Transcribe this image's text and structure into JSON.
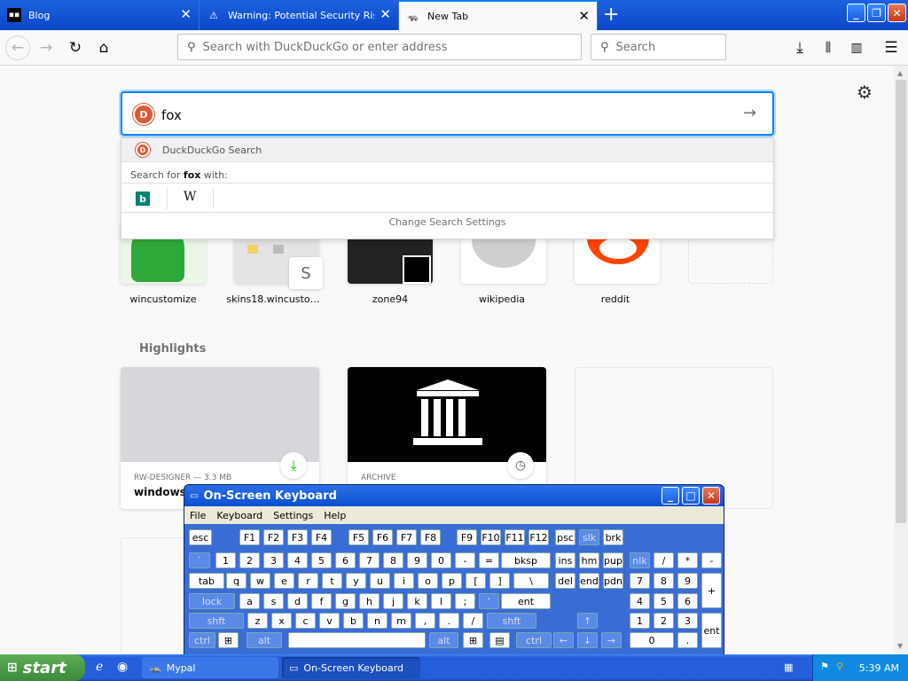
{
  "tabs": [
    {
      "label": "Blog",
      "icon": "terminal-icon"
    },
    {
      "label": "Warning: Potential Security Risk A",
      "icon": "warning-icon"
    },
    {
      "label": "New Tab",
      "icon": "ferret-icon"
    }
  ],
  "navbar": {
    "url_placeholder": "Search with DuckDuckGo or enter address",
    "search_placeholder": "Search"
  },
  "search": {
    "query": "fox",
    "dropdown_engine": "DuckDuckGo Search",
    "search_for_prefix": "Search for ",
    "search_for_term": "fox",
    "search_for_suffix": " with:",
    "change_settings": "Change Search Settings",
    "engine_icons": [
      "bing-icon",
      "wikipedia-icon"
    ]
  },
  "topsites": [
    {
      "label": "wincustomize"
    },
    {
      "label": "skins18.wincusto…",
      "badge": "S"
    },
    {
      "label": "zone94"
    },
    {
      "label": "wikipedia"
    },
    {
      "label": "reddit"
    }
  ],
  "highlights": {
    "title": "Highlights",
    "cards": [
      {
        "source": "RW-DESIGNER — 3.3 MB",
        "title": "windowsi"
      },
      {
        "source": "ARCHIVE",
        "title": ""
      }
    ]
  },
  "osk": {
    "title": "On-Screen Keyboard",
    "menu": [
      "File",
      "Keyboard",
      "Settings",
      "Help"
    ],
    "row0": [
      "esc",
      "F1",
      "F2",
      "F3",
      "F4",
      "F5",
      "F6",
      "F7",
      "F8",
      "F9",
      "F10",
      "F11",
      "F12",
      "psc",
      "slk",
      "brk"
    ],
    "row1": [
      "`",
      "1",
      "2",
      "3",
      "4",
      "5",
      "6",
      "7",
      "8",
      "9",
      "0",
      "-",
      "=",
      "bksp",
      "ins",
      "hm",
      "pup",
      "nlk",
      "/",
      "*",
      "-"
    ],
    "row2": [
      "tab",
      "q",
      "w",
      "e",
      "r",
      "t",
      "y",
      "u",
      "i",
      "o",
      "p",
      "[",
      "]",
      "\\",
      "del",
      "end",
      "pdn",
      "7",
      "8",
      "9",
      "+"
    ],
    "row3": [
      "lock",
      "a",
      "s",
      "d",
      "f",
      "g",
      "h",
      "j",
      "k",
      "l",
      ";",
      "'",
      "ent",
      "4",
      "5",
      "6"
    ],
    "row4": [
      "shft",
      "z",
      "x",
      "c",
      "v",
      "b",
      "n",
      "m",
      ",",
      ".",
      "/",
      "shft",
      "↑",
      "1",
      "2",
      "3",
      "ent"
    ],
    "row5": [
      "ctrl",
      "⊞",
      "alt",
      "",
      "alt",
      "⊞",
      "▤",
      "ctrl",
      "←",
      "↓",
      "→",
      "0",
      "."
    ]
  },
  "taskbar": {
    "start": "start",
    "tasks": [
      "Mypal",
      "On-Screen Keyboard"
    ],
    "clock": "5:39 AM"
  }
}
